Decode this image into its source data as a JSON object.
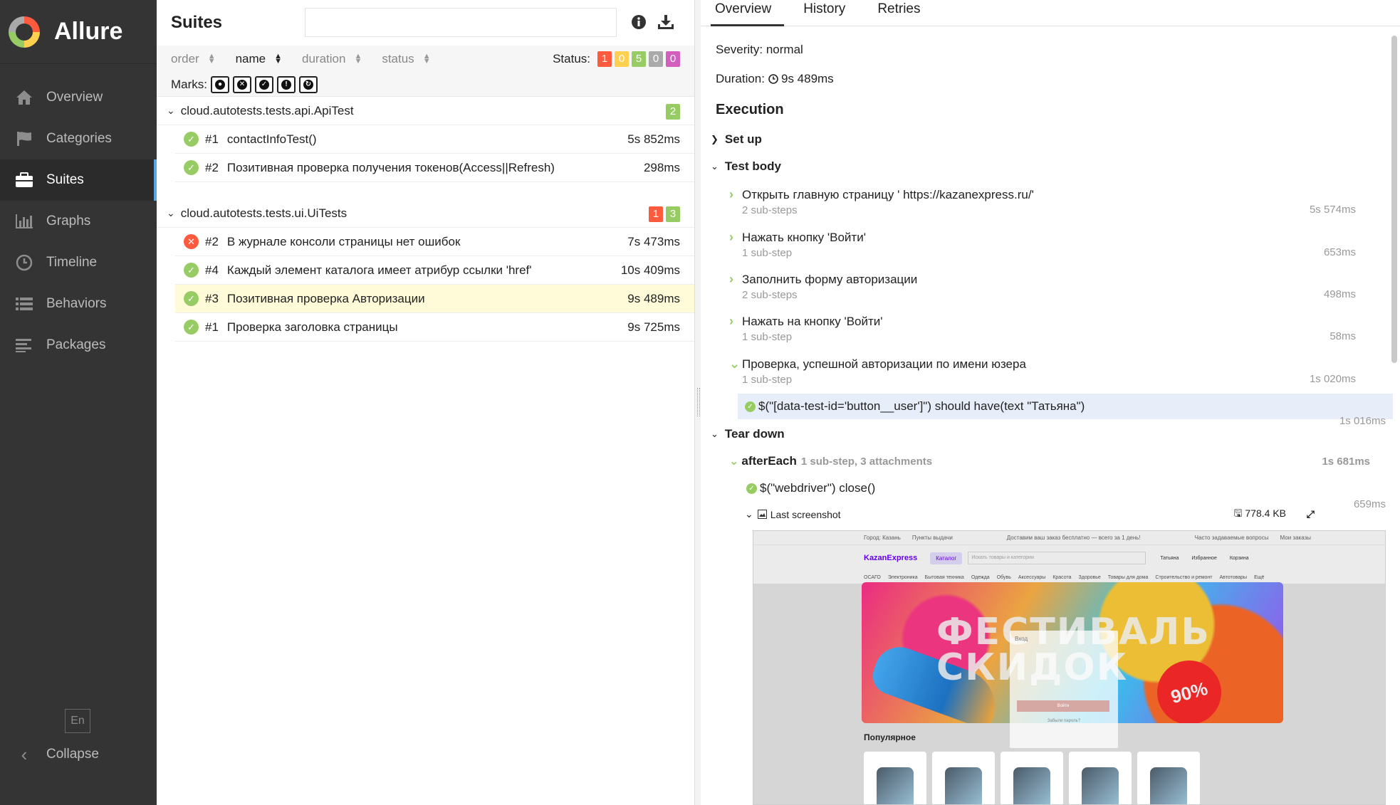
{
  "sidebar": {
    "brand": "Allure",
    "items": [
      {
        "label": "Overview",
        "icon": "home-icon"
      },
      {
        "label": "Categories",
        "icon": "flag-icon"
      },
      {
        "label": "Suites",
        "icon": "briefcase-icon",
        "active": true
      },
      {
        "label": "Graphs",
        "icon": "bar-chart-icon"
      },
      {
        "label": "Timeline",
        "icon": "clock-icon"
      },
      {
        "label": "Behaviors",
        "icon": "list-icon"
      },
      {
        "label": "Packages",
        "icon": "align-left-icon"
      }
    ],
    "language": "En",
    "collapse": "Collapse"
  },
  "suites": {
    "title": "Suites",
    "search_value": "",
    "sort": {
      "order": "order",
      "name": "name",
      "duration": "duration",
      "status": "status"
    },
    "status_label": "Status:",
    "status_counts": {
      "failed": "1",
      "broken": "0",
      "passed": "5",
      "skipped": "0",
      "unknown": "0"
    },
    "marks_label": "Marks:",
    "groups": [
      {
        "name": "cloud.autotests.tests.api.ApiTest",
        "badges": {
          "passed": "2"
        },
        "tests": [
          {
            "num": "#1",
            "name": "contactInfoTest()",
            "duration": "5s 852ms",
            "status": "passed"
          },
          {
            "num": "#2",
            "name": "Позитивная проверка получения токенов(Access||Refresh)",
            "duration": "298ms",
            "status": "passed"
          }
        ]
      },
      {
        "name": "cloud.autotests.tests.ui.UiTests",
        "badges": {
          "failed": "1",
          "passed": "3"
        },
        "tests": [
          {
            "num": "#2",
            "name": "В журнале консоли страницы нет ошибок",
            "duration": "7s 473ms",
            "status": "failed"
          },
          {
            "num": "#4",
            "name": "Каждый элемент каталога имеет атрибур ссылки 'href'",
            "duration": "10s 409ms",
            "status": "passed"
          },
          {
            "num": "#3",
            "name": "Позитивная проверка Авторизации",
            "duration": "9s 489ms",
            "status": "passed",
            "selected": true
          },
          {
            "num": "#1",
            "name": "Проверка заголовка страницы",
            "duration": "9s 725ms",
            "status": "passed"
          }
        ]
      }
    ]
  },
  "details": {
    "tabs": [
      "Overview",
      "History",
      "Retries"
    ],
    "severity": "Severity: normal",
    "duration_label": "Duration:",
    "duration_value": "9s 489ms",
    "execution_title": "Execution",
    "setup_label": "Set up",
    "test_body_label": "Test body",
    "steps": [
      {
        "name": "Открыть главную страницу ' https://kazanexpress.ru/'",
        "sub": "2 sub-steps",
        "duration": "5s 574ms"
      },
      {
        "name": "Нажать кнопку 'Войти'",
        "sub": "1 sub-step",
        "duration": "653ms"
      },
      {
        "name": "Заполнить форму авторизации",
        "sub": "2 sub-steps",
        "duration": "498ms"
      },
      {
        "name": "Нажать на кнопку 'Войти'",
        "sub": "1 sub-step",
        "duration": "58ms"
      },
      {
        "name": "Проверка, успешной авторизации по имени юзера",
        "sub": "1 sub-step",
        "duration": "1s 020ms"
      }
    ],
    "substep": {
      "name": "$(\"[data-test-id='button__user']\") should have(text \"Татьяна\")",
      "duration": "1s 016ms"
    },
    "teardown_label": "Tear down",
    "after_each": {
      "name": "afterEach",
      "meta": "1 sub-step, 3 attachments",
      "duration": "1s 681ms"
    },
    "webdriver_step": {
      "name": "$(\"webdriver\") close()",
      "duration": "659ms"
    },
    "attachment": {
      "name": "Last screenshot",
      "size": "778.4 KB"
    }
  },
  "screenshot": {
    "topbar": [
      "Город: Казань",
      "Пункты выдачи",
      "Доставим ваш заказ бесплатно — всего за 1 день!",
      "Часто задаваемые вопросы",
      "Мои заказы"
    ],
    "logo": "KazanExpress",
    "catalog": "Каталог",
    "search_placeholder": "Искать товары и категории",
    "links": [
      "Татьяна",
      "Избранное",
      "Корзина"
    ],
    "categories": [
      "ОСАГО",
      "Электроника",
      "Бытовая техника",
      "Одежда",
      "Обувь",
      "Аксессуары",
      "Красота",
      "Здоровье",
      "Товары для дома",
      "Строительство и ремонт",
      "Автотовары",
      "Ещё"
    ],
    "banner_text_line1": "ФЕСТИВАЛЬ",
    "banner_text_line2": "СКИДОК",
    "banner_promo": "90%",
    "modal_title": "Вход",
    "modal_button": "Войти",
    "modal_link": "Забыли пароль?",
    "popular": "Популярное"
  }
}
